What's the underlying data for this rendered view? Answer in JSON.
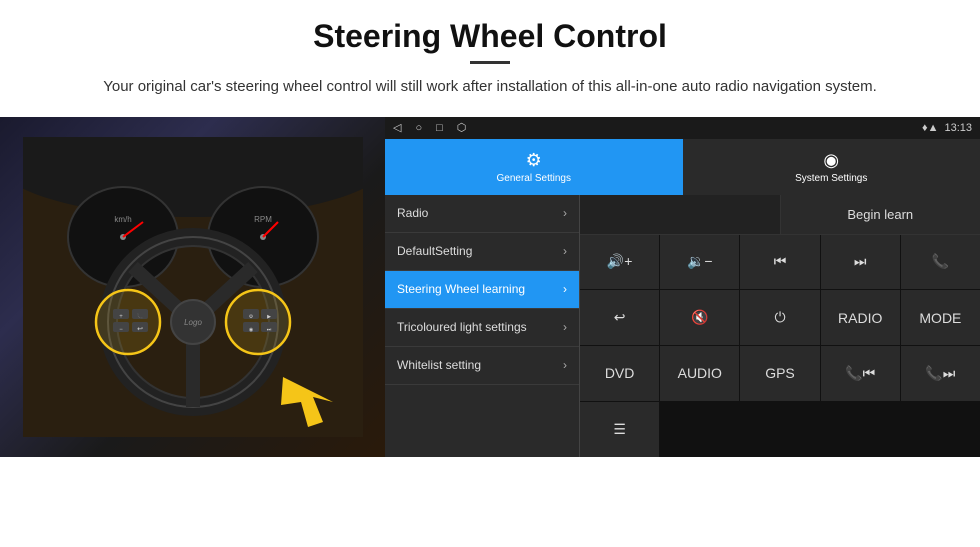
{
  "header": {
    "title": "Steering Wheel Control",
    "subtitle": "Your original car's steering wheel control will still work after installation of this all-in-one auto radio navigation system."
  },
  "status_bar": {
    "time": "13:13",
    "nav_icon": "◁",
    "home_icon": "○",
    "recent_icon": "□",
    "cast_icon": "⬡",
    "location_icon": "♦",
    "wifi_icon": "▲"
  },
  "tabs": {
    "general": {
      "label": "General Settings",
      "icon": "⚙"
    },
    "system": {
      "label": "System Settings",
      "icon": "◉"
    }
  },
  "menu": {
    "items": [
      {
        "label": "Radio",
        "active": false
      },
      {
        "label": "DefaultSetting",
        "active": false
      },
      {
        "label": "Steering Wheel learning",
        "active": true
      },
      {
        "label": "Tricoloured light settings",
        "active": false
      },
      {
        "label": "Whitelist setting",
        "active": false
      }
    ]
  },
  "controls": {
    "begin_learn_label": "Begin learn",
    "buttons_row1": [
      {
        "label": "🔊+",
        "id": "vol-up"
      },
      {
        "label": "🔉−",
        "id": "vol-down"
      },
      {
        "label": "⏮",
        "id": "prev"
      },
      {
        "label": "⏭",
        "id": "next"
      },
      {
        "label": "📞",
        "id": "call"
      }
    ],
    "buttons_row2": [
      {
        "label": "↩",
        "id": "hang-up"
      },
      {
        "label": "🔇",
        "id": "mute"
      },
      {
        "label": "⏻",
        "id": "power"
      },
      {
        "label": "RADIO",
        "id": "radio"
      },
      {
        "label": "MODE",
        "id": "mode"
      }
    ],
    "buttons_row3": [
      {
        "label": "DVD",
        "id": "dvd"
      },
      {
        "label": "AUDIO",
        "id": "audio"
      },
      {
        "label": "GPS",
        "id": "gps"
      },
      {
        "label": "📞⏮",
        "id": "call-prev"
      },
      {
        "label": "📞⏭",
        "id": "call-next"
      }
    ],
    "buttons_row4": [
      {
        "label": "≡",
        "id": "menu-icon"
      }
    ]
  }
}
